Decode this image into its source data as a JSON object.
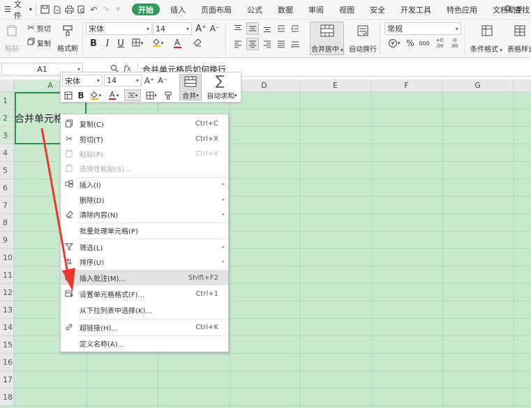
{
  "menubar": {
    "file_label": "文件",
    "tabs": [
      "开始",
      "插入",
      "页面布局",
      "公式",
      "数据",
      "审阅",
      "视图",
      "安全",
      "开发工具",
      "特色应用",
      "文档助手"
    ],
    "active_tab": "开始",
    "search_label": "查找"
  },
  "ribbon": {
    "paste": "粘贴",
    "cut": "剪切",
    "copy": "复制",
    "format_painter": "格式刷",
    "font_name": "宋体",
    "font_size": "14",
    "bold": "B",
    "italic": "I",
    "underline": "U",
    "font_color_letter": "A",
    "increase_font": "A⁺",
    "decrease_font": "A⁻",
    "merge_center": "合并居中",
    "wrap_text": "自动换行",
    "number_format": "常规",
    "currency": "¥",
    "percent": "%",
    "thousands": "000",
    "inc_decimal": "+0 .00",
    "dec_decimal": "-0 .00",
    "conditional_format": "条件格式",
    "table_style": "表格样式"
  },
  "formula_bar": {
    "cell_ref": "A1",
    "fx": "fx",
    "content": "合并单元格后如何换行"
  },
  "grid": {
    "columns": [
      "A",
      "B",
      "C",
      "D",
      "E",
      "F",
      "G"
    ],
    "rows": [
      "1",
      "2",
      "3",
      "4",
      "5",
      "6",
      "7",
      "8",
      "9",
      "10",
      "11",
      "12",
      "13",
      "14",
      "15",
      "16",
      "17",
      "18"
    ],
    "cell_text": "合并单元格后"
  },
  "mini_toolbar": {
    "font_name": "宋体",
    "font_size": "14",
    "bold": "B",
    "font_color_letter": "A",
    "merge": "合并",
    "autosum": "自动求和"
  },
  "context_menu": {
    "items": [
      {
        "label": "复制(C)",
        "shortcut": "Ctrl+C",
        "icon": "copy-icon"
      },
      {
        "label": "剪切(T)",
        "shortcut": "Ctrl+X",
        "icon": "scissors-icon"
      },
      {
        "label": "粘贴(P)",
        "shortcut": "Ctrl+V",
        "icon": "paste-icon",
        "disabled": true
      },
      {
        "label": "选择性粘贴(S)...",
        "shortcut": "",
        "icon": "paste-special-icon",
        "disabled": true
      },
      {
        "label": "插入(I)",
        "shortcut": "",
        "icon": "insert-icon",
        "submenu": true
      },
      {
        "label": "删除(D)",
        "shortcut": "",
        "icon": "",
        "submenu": true
      },
      {
        "label": "清除内容(N)",
        "shortcut": "",
        "icon": "eraser-icon",
        "submenu": true
      },
      {
        "label": "批量处理单元格(P)",
        "shortcut": "",
        "icon": ""
      },
      {
        "label": "筛选(L)",
        "shortcut": "",
        "icon": "filter-icon",
        "submenu": true
      },
      {
        "label": "排序(U)",
        "shortcut": "",
        "icon": "sort-icon",
        "submenu": true
      },
      {
        "label": "插入批注(M)...",
        "shortcut": "Shift+F2",
        "icon": "comment-icon",
        "highlighted": true
      },
      {
        "label": "设置单元格格式(F)...",
        "shortcut": "Ctrl+1",
        "icon": "format-cells-icon"
      },
      {
        "label": "从下拉列表中选择(K)...",
        "shortcut": "",
        "icon": ""
      },
      {
        "label": "超链接(H)...",
        "shortcut": "Ctrl+K",
        "icon": "link-icon"
      },
      {
        "label": "定义名称(A)...",
        "shortcut": "",
        "icon": ""
      }
    ]
  },
  "colors": {
    "accent": "#2e9c57",
    "grid_bg": "#c9e9cf",
    "arrow": "#e8392b"
  }
}
